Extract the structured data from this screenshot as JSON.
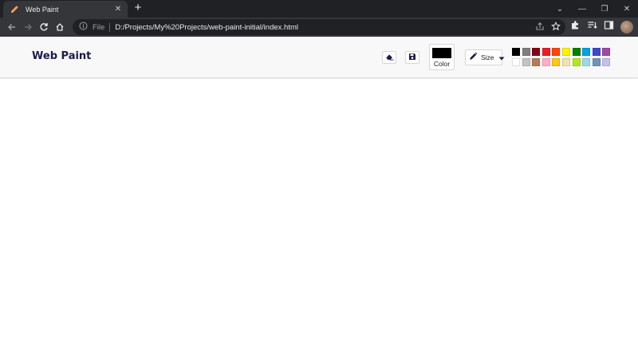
{
  "browser": {
    "tab_title": "Web Paint",
    "new_tab_icon": "plus-icon",
    "omnibox": {
      "scheme_label": "File",
      "url": "D:/Projects/My%20Projects/web-paint-initial/index.html"
    }
  },
  "app": {
    "title": "Web Paint",
    "toolbar": {
      "eraser_icon": "eraser-icon",
      "save_icon": "floppy-disk-icon",
      "color_label": "Color",
      "current_color": "#000000",
      "size_label": "Size"
    },
    "palette": [
      "#000000",
      "#7f7f7f",
      "#880015",
      "#ed1c24",
      "#ff4500",
      "#fff200",
      "#008000",
      "#00a2e8",
      "#3f48cc",
      "#a349a4",
      "#ffffff",
      "#c3c3c3",
      "#b97a57",
      "#ffaec9",
      "#ffc90e",
      "#efe4b0",
      "#b5e61d",
      "#99d9ea",
      "#7092be",
      "#c8bfe7"
    ]
  }
}
